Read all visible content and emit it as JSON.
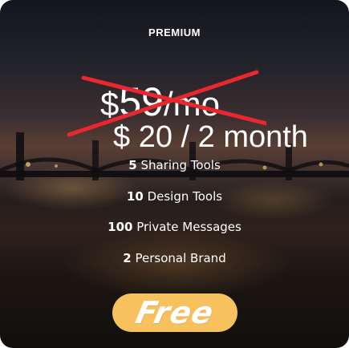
{
  "plan": {
    "name": "PREMIUM",
    "old_price_symbol": "$",
    "old_price_amount": "59",
    "old_price_period": "/mo",
    "new_price": "$ 20 / 2 month"
  },
  "features": [
    {
      "count": "5",
      "label": "Sharing Tools"
    },
    {
      "count": "10",
      "label": "Design Tools"
    },
    {
      "count": "100",
      "label": "Private Messages"
    },
    {
      "count": "2",
      "label": "Personal Brand"
    }
  ],
  "cta": {
    "label": "Free"
  },
  "colors": {
    "button": "#f7c25e",
    "strike": "#e8272f",
    "text": "#ffffff"
  }
}
